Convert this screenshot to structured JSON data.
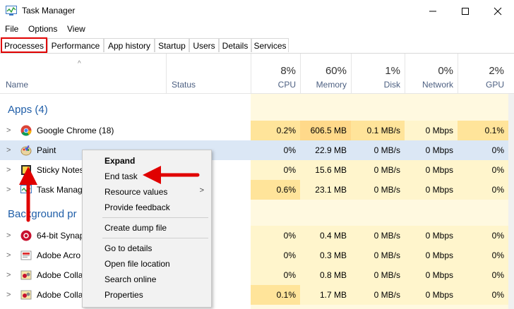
{
  "window": {
    "title": "Task Manager"
  },
  "menu": [
    "File",
    "Options",
    "View"
  ],
  "tabs": [
    "Processes",
    "Performance",
    "App history",
    "Startup",
    "Users",
    "Details",
    "Services"
  ],
  "header": {
    "name": "Name",
    "status": "Status",
    "cpu": {
      "pct": "8%",
      "label": "CPU"
    },
    "memory": {
      "pct": "60%",
      "label": "Memory"
    },
    "disk": {
      "pct": "1%",
      "label": "Disk"
    },
    "network": {
      "pct": "0%",
      "label": "Network"
    },
    "gpu": {
      "pct": "2%",
      "label": "GPU"
    }
  },
  "groups": {
    "apps": "Apps (4)",
    "background": "Background pr"
  },
  "processes": [
    {
      "name": "Google Chrome (18)",
      "cpu": "0.2%",
      "memory": "606.5 MB",
      "disk": "0.1 MB/s",
      "network": "0 Mbps",
      "gpu": "0.1%",
      "icon": "chrome-icon"
    },
    {
      "name": "Paint",
      "cpu": "0%",
      "memory": "22.9 MB",
      "disk": "0 MB/s",
      "network": "0 Mbps",
      "gpu": "0%",
      "icon": "paint-icon"
    },
    {
      "name": "Sticky Notes",
      "cpu": "0%",
      "memory": "15.6 MB",
      "disk": "0 MB/s",
      "network": "0 Mbps",
      "gpu": "0%",
      "icon": "sticky-notes-icon"
    },
    {
      "name": "Task Manag",
      "cpu": "0.6%",
      "memory": "23.1 MB",
      "disk": "0 MB/s",
      "network": "0 Mbps",
      "gpu": "0%",
      "icon": "task-manager-icon"
    },
    {
      "name": "64-bit Synap",
      "cpu": "0%",
      "memory": "0.4 MB",
      "disk": "0 MB/s",
      "network": "0 Mbps",
      "gpu": "0%",
      "icon": "synaptics-icon"
    },
    {
      "name": "Adobe Acro",
      "cpu": "0%",
      "memory": "0.3 MB",
      "disk": "0 MB/s",
      "network": "0 Mbps",
      "gpu": "0%",
      "icon": "adobe-icon"
    },
    {
      "name": "Adobe Colla",
      "cpu": "0%",
      "memory": "0.8 MB",
      "disk": "0 MB/s",
      "network": "0 Mbps",
      "gpu": "0%",
      "icon": "adobe-collab-icon"
    },
    {
      "name": "Adobe Colla",
      "cpu": "0.1%",
      "memory": "1.7 MB",
      "disk": "0 MB/s",
      "network": "0 Mbps",
      "gpu": "0%",
      "icon": "adobe-collab-icon"
    }
  ],
  "context_menu": {
    "expand": "Expand",
    "end_task": "End task",
    "resource_values": "Resource values",
    "provide_feedback": "Provide feedback",
    "create_dump": "Create dump file",
    "go_to_details": "Go to details",
    "open_file_location": "Open file location",
    "search_online": "Search online",
    "properties": "Properties"
  },
  "colors": {
    "annotation": "#e00000",
    "selection": "#dbe7f5",
    "heat": "#fff5cc",
    "group": "#1f5ea8"
  }
}
